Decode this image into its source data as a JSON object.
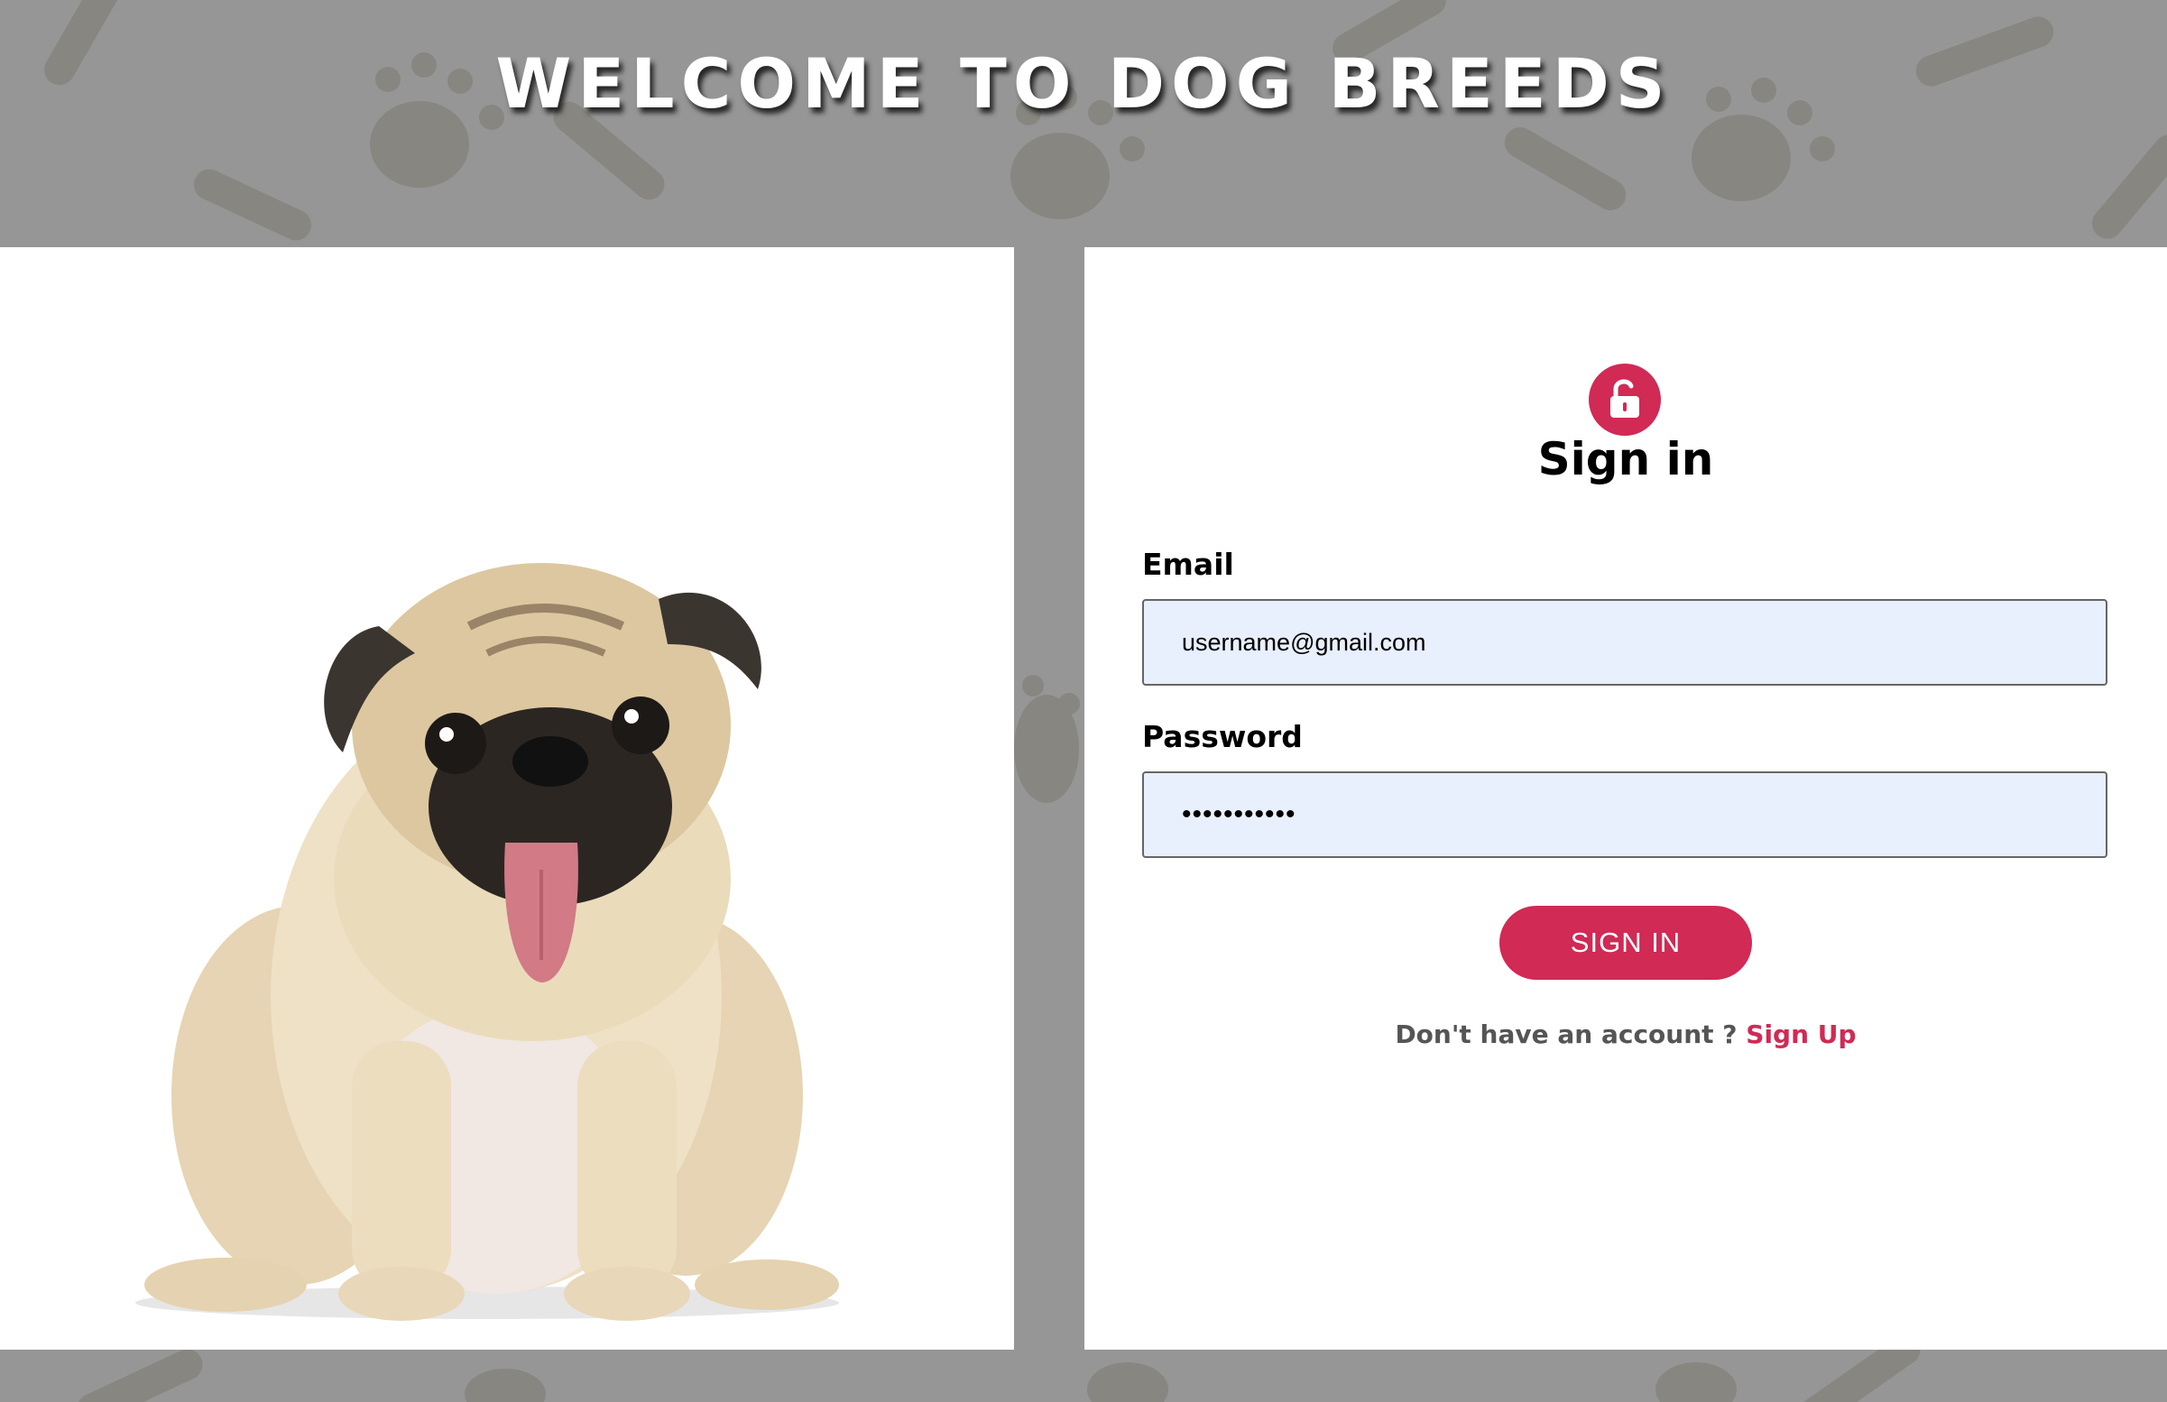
{
  "page": {
    "title": "WELCOME TO DOG BREEDS",
    "background_color": "#969696",
    "accent_color": "#d02a55"
  },
  "hero_image": {
    "description_icon": "pug-dog-photo"
  },
  "signin_form": {
    "icon": "lock-open-icon",
    "heading": "Sign in",
    "email_label": "Email",
    "email_value": "username@gmail.com",
    "password_label": "Password",
    "password_value": "•••••••••••",
    "submit_label": "SIGN IN",
    "no_account_text": "Don't have an account ?",
    "signup_link": "Sign Up"
  }
}
